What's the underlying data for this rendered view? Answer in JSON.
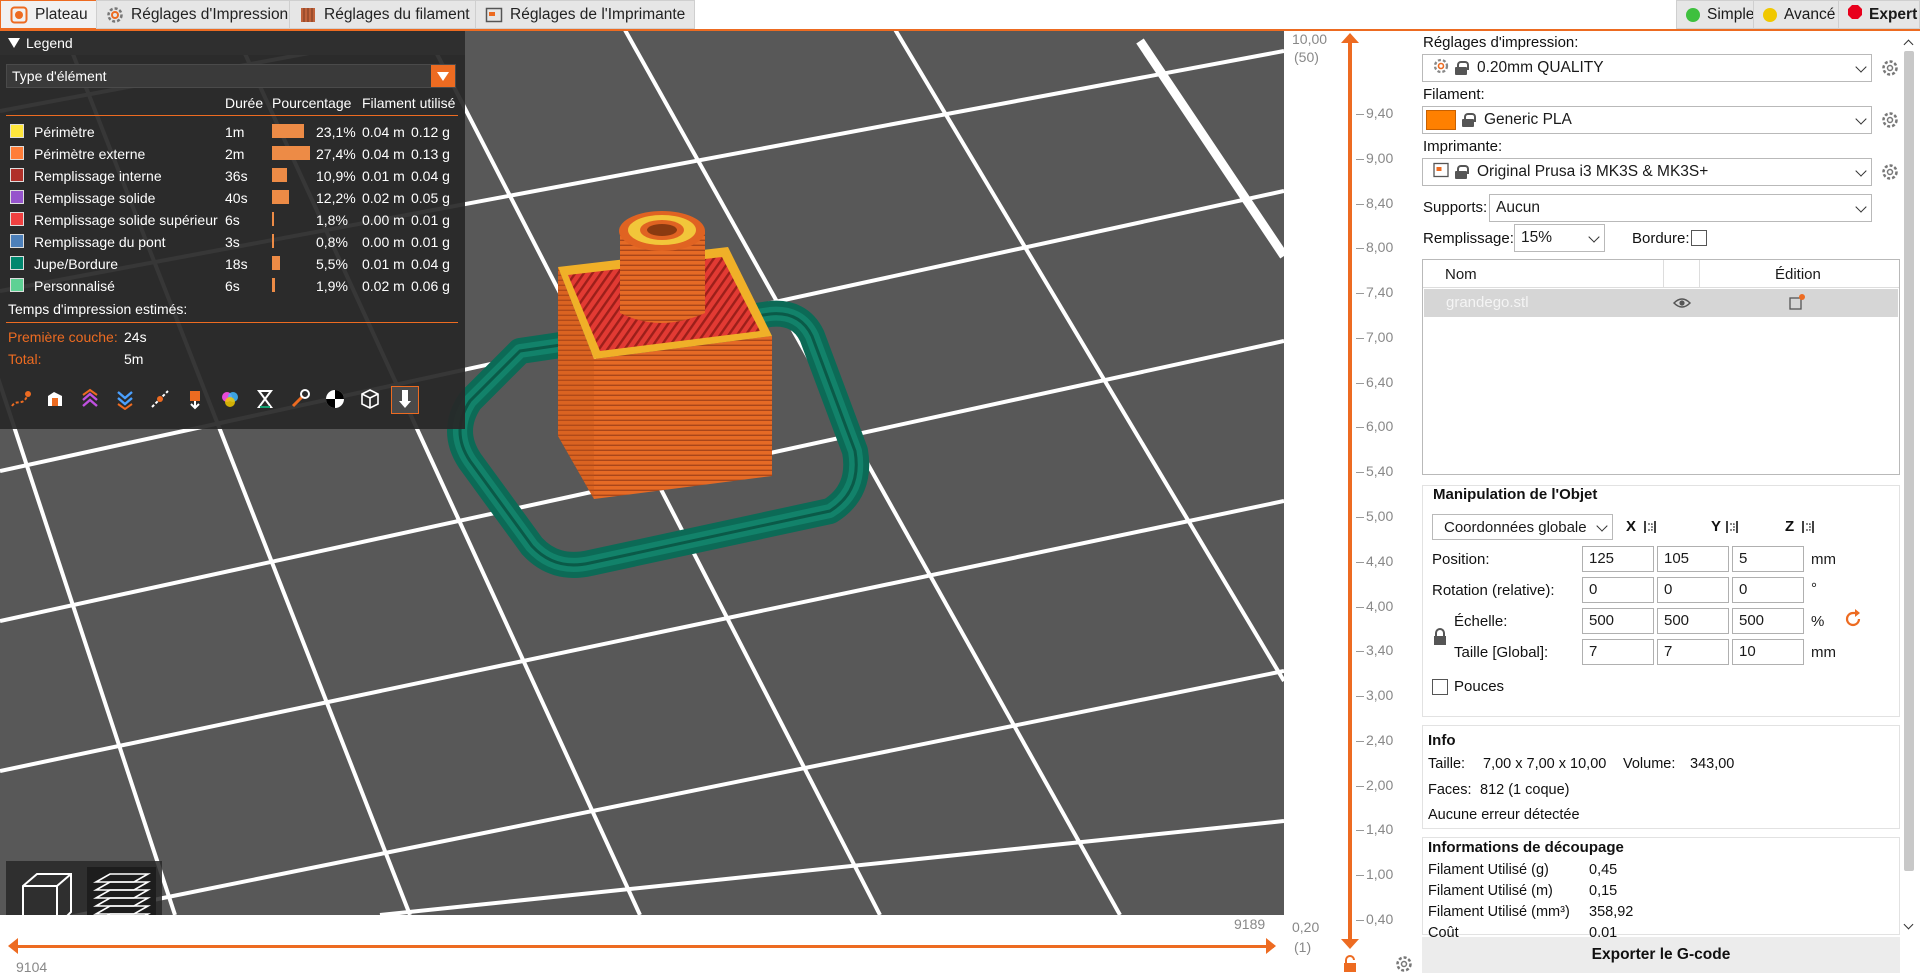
{
  "tabs": [
    {
      "label": "Plateau",
      "icon": "plate-icon"
    },
    {
      "label": "Réglages d'Impression",
      "icon": "print-settings-gear-icon"
    },
    {
      "label": "Réglages du filament",
      "icon": "filament-spool-icon"
    },
    {
      "label": "Réglages de l'Imprimante",
      "icon": "printer-icon"
    }
  ],
  "modes": [
    {
      "label": "Simple",
      "color": "#3ec03e"
    },
    {
      "label": "Avancé",
      "color": "#f0c800"
    },
    {
      "label": "Expert",
      "color": "#e8001c"
    }
  ],
  "legend": {
    "title": "Legend",
    "view_type": "Type d'élément",
    "columns": {
      "duration": "Durée",
      "percentage": "Pourcentage",
      "filament": "Filament utilisé"
    },
    "rows": [
      {
        "name": "Périmètre",
        "color": "#ffe63c",
        "time": "1m",
        "pct": "23,1%",
        "pct_value": 23.1,
        "length": "0.04 m",
        "weight": "0.12 g"
      },
      {
        "name": "Périmètre externe",
        "color": "#ff7d38",
        "time": "2m",
        "pct": "27,4%",
        "pct_value": 27.4,
        "length": "0.04 m",
        "weight": "0.13 g"
      },
      {
        "name": "Remplissage interne",
        "color": "#b03029",
        "time": "36s",
        "pct": "10,9%",
        "pct_value": 10.9,
        "length": "0.01 m",
        "weight": "0.04 g"
      },
      {
        "name": "Remplissage solide",
        "color": "#9654cc",
        "time": "40s",
        "pct": "12,2%",
        "pct_value": 12.2,
        "length": "0.02 m",
        "weight": "0.05 g"
      },
      {
        "name": "Remplissage solide supérieur",
        "color": "#f04040",
        "time": "6s",
        "pct": "1,8%",
        "pct_value": 1.8,
        "length": "0.00 m",
        "weight": "0.01 g"
      },
      {
        "name": "Remplissage du pont",
        "color": "#4d80ba",
        "time": "3s",
        "pct": "0,8%",
        "pct_value": 0.8,
        "length": "0.00 m",
        "weight": "0.01 g"
      },
      {
        "name": "Jupe/Bordure",
        "color": "#00876e",
        "time": "18s",
        "pct": "5,5%",
        "pct_value": 5.5,
        "length": "0.01 m",
        "weight": "0.04 g"
      },
      {
        "name": "Personnalisé",
        "color": "#5ed194",
        "time": "6s",
        "pct": "1,9%",
        "pct_value": 1.9,
        "length": "0.02 m",
        "weight": "0.06 g"
      }
    ],
    "estimated_title": "Temps d'impression estimés:",
    "first_layer_label": "Première couche:",
    "first_layer_value": "24s",
    "total_label": "Total:",
    "total_value": "5m",
    "tools": [
      "travel-icon",
      "wipe-icon",
      "retractions-icon",
      "deretractions-icon",
      "seams-icon",
      "tool-changes-icon",
      "color-changes-icon",
      "pause-icon",
      "custom-gcode-icon",
      "cog-icon",
      "shells-icon",
      "tool-marker-icon"
    ]
  },
  "hslider": {
    "left_value": "9104",
    "right_value": "9189"
  },
  "vslider": {
    "top_value": "10,00",
    "top_layer": "(50)",
    "bottom_value": "0,20",
    "bottom_layer": "(1)",
    "ticks": [
      "10,00",
      "9,40",
      "9,00",
      "8,40",
      "8,00",
      "7,40",
      "7,00",
      "6,40",
      "6,00",
      "5,40",
      "5,00",
      "4,40",
      "4,00",
      "3,40",
      "3,00",
      "2,40",
      "2,00",
      "1,40",
      "1,00",
      "0,40"
    ]
  },
  "sidebar": {
    "print_label": "Réglages d'impression:",
    "print_value": "0.20mm QUALITY",
    "filament_label": "Filament:",
    "filament_value": "Generic PLA",
    "filament_color": "#ff8000",
    "printer_label": "Imprimante:",
    "printer_value": "Original Prusa i3 MK3S & MK3S+",
    "supports_label": "Supports:",
    "supports_value": "Aucun",
    "infill_label": "Remplissage:",
    "infill_value": "15%",
    "brim_label": "Bordure:",
    "objects": {
      "col_name": "Nom",
      "col_edit": "Édition",
      "items": [
        {
          "name": "grandego.stl"
        }
      ]
    },
    "manip": {
      "title": "Manipulation de l'Objet",
      "coords": "Coordonnées globale",
      "axis_x": "X",
      "axis_y": "Y",
      "axis_z": "Z",
      "position_label": "Position:",
      "position": [
        "125",
        "105",
        "5"
      ],
      "position_unit": "mm",
      "rotation_label": "Rotation (relative):",
      "rotation": [
        "0",
        "0",
        "0"
      ],
      "rotation_unit": "°",
      "scale_label": "Échelle:",
      "scale": [
        "500",
        "500",
        "500"
      ],
      "scale_unit": "%",
      "size_label": "Taille [Global]:",
      "size": [
        "7",
        "7",
        "10"
      ],
      "size_unit": "mm",
      "inches_label": "Pouces"
    },
    "info": {
      "title": "Info",
      "size_label": "Taille:",
      "size_value": "7,00 x 7,00 x 10,00",
      "volume_label": "Volume:",
      "volume_value": "343,00",
      "faces_label": "Faces:",
      "faces_value": "812 (1 coque)",
      "errors": "Aucune erreur détectée"
    },
    "slice": {
      "title": "Informations de découpage",
      "rows": [
        {
          "label": "Filament Utilisé (g)",
          "value": "0,45"
        },
        {
          "label": "Filament Utilisé (m)",
          "value": "0,15"
        },
        {
          "label": "Filament Utilisé (mm³)",
          "value": "358,92"
        },
        {
          "label": "Coût",
          "value": "0,01"
        }
      ]
    },
    "export_label": "Exporter le G-code"
  }
}
